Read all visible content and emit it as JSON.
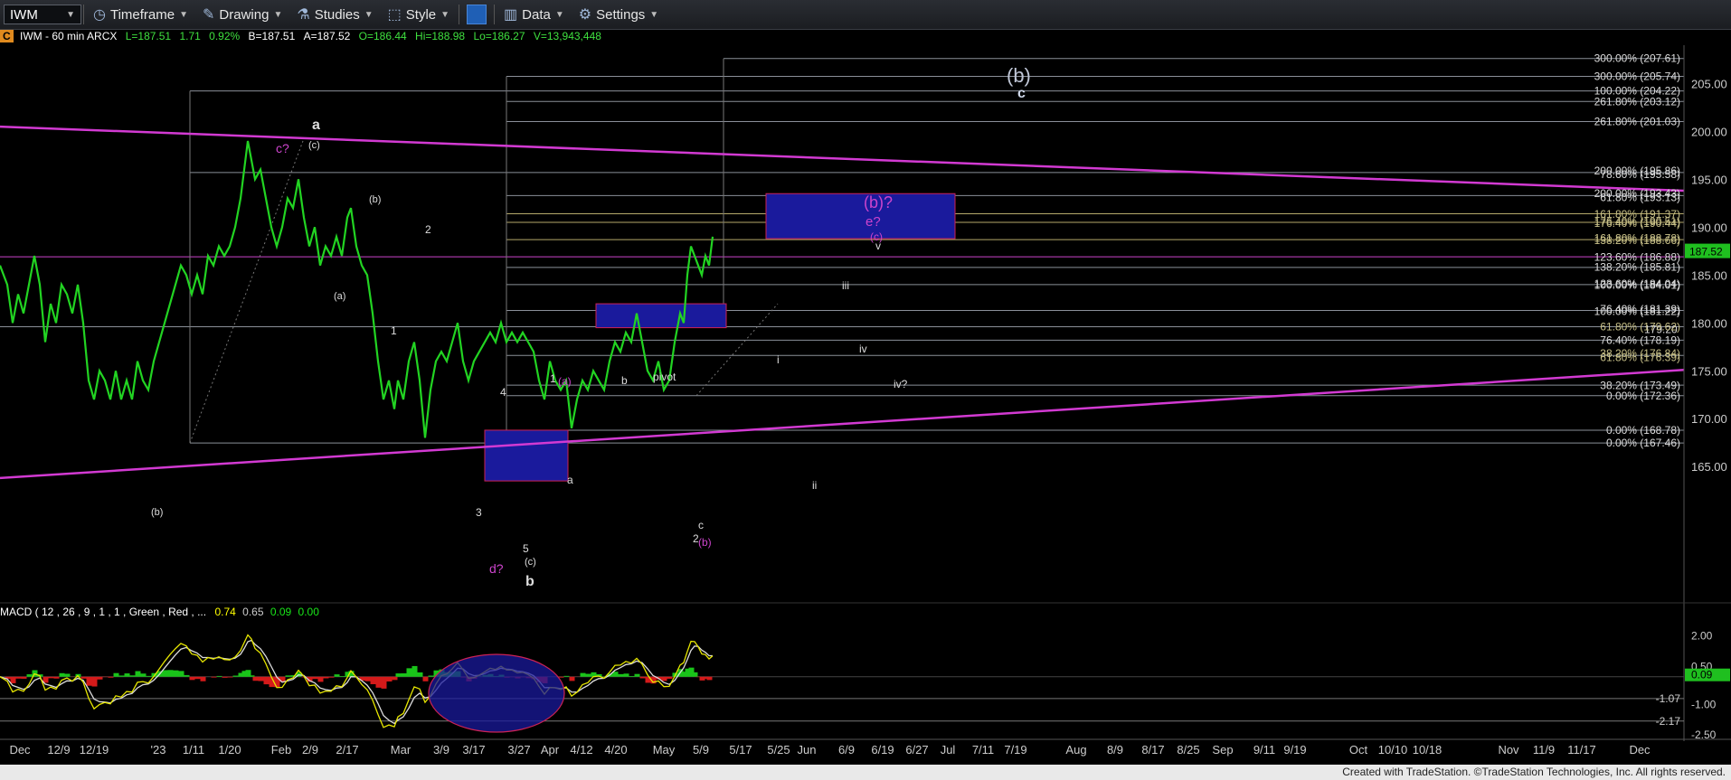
{
  "toolbar": {
    "symbol": "IWM",
    "timeframe": "Timeframe",
    "drawing": "Drawing",
    "studies": "Studies",
    "style": "Style",
    "data": "Data",
    "settings": "Settings"
  },
  "info": {
    "badge": "C",
    "name": "IWM - 60 min  ARCX",
    "last": "L=187.51",
    "chg": "1.71",
    "pct": "0.92%",
    "bid": "B=187.51",
    "ask": "A=187.52",
    "open": "O=186.44",
    "hi": "Hi=188.98",
    "lo": "Lo=186.27",
    "vol": "V=13,943,448"
  },
  "macd_info": {
    "name": "MACD ( 12 , 26 , 9 , 1 , 1 , Green , Red , ...",
    "v1": "0.74",
    "v2": "0.65",
    "v3": "0.09",
    "v4": "0.00"
  },
  "footer": "Created with TradeStation. ©TradeStation Technologies, Inc. All rights reserved.",
  "chart_data": [
    {
      "type": "line",
      "ylim": [
        162,
        209
      ],
      "price_ticks": [
        165,
        170,
        175,
        180,
        185,
        190,
        195,
        200,
        205
      ],
      "current_price": "187.52",
      "price_marker": "179.20",
      "x_labels": [
        "Dec",
        "12/9",
        "12/19",
        "'23",
        "1/11",
        "1/20",
        "Feb",
        "2/9",
        "2/17",
        "Mar",
        "3/9",
        "3/17",
        "3/27",
        "Apr",
        "4/12",
        "4/20",
        "May",
        "5/9",
        "5/17",
        "5/25",
        "Jun",
        "6/9",
        "6/19",
        "6/27",
        "Jul",
        "7/11",
        "7/19",
        "Aug",
        "8/9",
        "8/17",
        "8/25",
        "Sep",
        "9/11",
        "9/19",
        "Oct",
        "10/10",
        "10/18",
        "Nov",
        "11/9",
        "11/17",
        "Dec"
      ],
      "price_series": [
        [
          0,
          186
        ],
        [
          8,
          184
        ],
        [
          14,
          180
        ],
        [
          20,
          183
        ],
        [
          26,
          181
        ],
        [
          32,
          184
        ],
        [
          38,
          187
        ],
        [
          44,
          184
        ],
        [
          50,
          178
        ],
        [
          56,
          182
        ],
        [
          62,
          180
        ],
        [
          68,
          184
        ],
        [
          74,
          183
        ],
        [
          80,
          181
        ],
        [
          86,
          184
        ],
        [
          92,
          180
        ],
        [
          98,
          174
        ],
        [
          104,
          172
        ],
        [
          110,
          175
        ],
        [
          116,
          174
        ],
        [
          122,
          172
        ],
        [
          128,
          175
        ],
        [
          134,
          172
        ],
        [
          140,
          174
        ],
        [
          146,
          172
        ],
        [
          152,
          176
        ],
        [
          158,
          174
        ],
        [
          164,
          173
        ],
        [
          170,
          176
        ],
        [
          176,
          178
        ],
        [
          182,
          180
        ],
        [
          188,
          182
        ],
        [
          194,
          184
        ],
        [
          200,
          186
        ],
        [
          206,
          185
        ],
        [
          212,
          183
        ],
        [
          218,
          185
        ],
        [
          224,
          183
        ],
        [
          230,
          187
        ],
        [
          236,
          186
        ],
        [
          242,
          188
        ],
        [
          248,
          187
        ],
        [
          254,
          188
        ],
        [
          260,
          190
        ],
        [
          266,
          193
        ],
        [
          270,
          196
        ],
        [
          274,
          199
        ],
        [
          278,
          197
        ],
        [
          282,
          195
        ],
        [
          288,
          196
        ],
        [
          294,
          193
        ],
        [
          300,
          190
        ],
        [
          306,
          188
        ],
        [
          312,
          190
        ],
        [
          318,
          193
        ],
        [
          324,
          192
        ],
        [
          330,
          195
        ],
        [
          336,
          191
        ],
        [
          342,
          188
        ],
        [
          348,
          190
        ],
        [
          354,
          186
        ],
        [
          360,
          188
        ],
        [
          366,
          187
        ],
        [
          372,
          189
        ],
        [
          378,
          187
        ],
        [
          384,
          191
        ],
        [
          388,
          192
        ],
        [
          394,
          188
        ],
        [
          400,
          186
        ],
        [
          406,
          185
        ],
        [
          412,
          181
        ],
        [
          418,
          176
        ],
        [
          424,
          172
        ],
        [
          430,
          174
        ],
        [
          436,
          171
        ],
        [
          440,
          174
        ],
        [
          446,
          172
        ],
        [
          452,
          176
        ],
        [
          458,
          178
        ],
        [
          464,
          174
        ],
        [
          470,
          168
        ],
        [
          476,
          173
        ],
        [
          482,
          176
        ],
        [
          488,
          177
        ],
        [
          494,
          176
        ],
        [
          500,
          178
        ],
        [
          506,
          180
        ],
        [
          512,
          176
        ],
        [
          518,
          174
        ],
        [
          524,
          176
        ],
        [
          530,
          177
        ],
        [
          536,
          178
        ],
        [
          542,
          179
        ],
        [
          548,
          178
        ],
        [
          554,
          180
        ],
        [
          560,
          178
        ],
        [
          566,
          179
        ],
        [
          572,
          178
        ],
        [
          578,
          179
        ],
        [
          584,
          178
        ],
        [
          590,
          177
        ],
        [
          596,
          174
        ],
        [
          602,
          172
        ],
        [
          608,
          176
        ],
        [
          614,
          174
        ],
        [
          620,
          173
        ],
        [
          626,
          174
        ],
        [
          632,
          169
        ],
        [
          638,
          172
        ],
        [
          644,
          174
        ],
        [
          650,
          173
        ],
        [
          656,
          175
        ],
        [
          662,
          174
        ],
        [
          668,
          173
        ],
        [
          674,
          176
        ],
        [
          680,
          178
        ],
        [
          686,
          177
        ],
        [
          692,
          179
        ],
        [
          698,
          178
        ],
        [
          704,
          181
        ],
        [
          710,
          178
        ],
        [
          716,
          175
        ],
        [
          722,
          174
        ],
        [
          728,
          176
        ],
        [
          734,
          173
        ],
        [
          740,
          174
        ],
        [
          746,
          178
        ],
        [
          752,
          181
        ],
        [
          756,
          180
        ],
        [
          760,
          185
        ],
        [
          764,
          188
        ],
        [
          768,
          187
        ],
        [
          772,
          186
        ],
        [
          776,
          185
        ],
        [
          780,
          187
        ],
        [
          784,
          186
        ],
        [
          788,
          189
        ]
      ],
      "macd_ticks": [
        "2.00",
        "0.50",
        "-1.07",
        "-1.00",
        "-2.17",
        "-2.50"
      ],
      "macd_current": "0.09",
      "fib_labels": [
        "300.00% (207.61)",
        "300.00% (205.74)",
        "100.00% (204.22)",
        "261.80% (203.12)",
        "261.80% (201.03)",
        "200.00% (195.86)",
        "78.60% (195.58)",
        "200.00% (193.43)",
        "61.80% (193.13)",
        "161.80% (191.37)",
        "176.40% (190.51)",
        "176.40% (190.44)",
        "161.80% (188.78)",
        "138.20% (188.66)",
        "123.60% (186.88)",
        "138.20% (185.81)",
        "123.60% (184.04)",
        "100.00% (184.01)",
        "76.40% (181.39)",
        "100.00% (181.22)",
        "61.80% (179.62)",
        "76.40% (178.19)",
        "38.20% (176.84)",
        "61.80% (176.39)",
        "38.20% (173.49)",
        "0.00% (172.36)",
        "0.00% (168.78)",
        "0.00% (167.46)"
      ],
      "wave_labels": {
        "white": [
          "a",
          "(c)",
          "(b)",
          "2",
          "(a)",
          "1",
          "(b)",
          "4",
          "3",
          "5",
          "(c)",
          "b",
          "1",
          "b",
          "a",
          "pivot",
          "i",
          "ii",
          "iii",
          "iv",
          "iv?",
          "v",
          "c",
          "2",
          "(b)",
          "c"
        ],
        "magenta": [
          "c?",
          "(a)",
          "d?",
          "(b)",
          "(b)?",
          "e?",
          "(c)"
        ]
      }
    }
  ]
}
